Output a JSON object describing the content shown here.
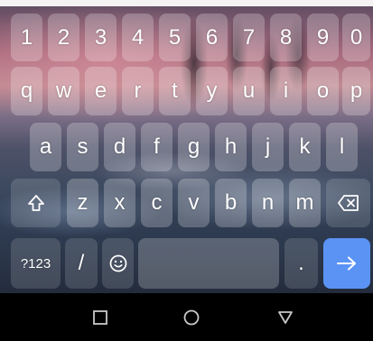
{
  "keyboard": {
    "numbers": [
      "1",
      "2",
      "3",
      "4",
      "5",
      "6",
      "7",
      "8",
      "9",
      "0"
    ],
    "row_q": [
      "q",
      "w",
      "e",
      "r",
      "t",
      "y",
      "u",
      "i",
      "o",
      "p"
    ],
    "row_a": [
      "a",
      "s",
      "d",
      "f",
      "g",
      "h",
      "j",
      "k",
      "l"
    ],
    "row_z": [
      "z",
      "x",
      "c",
      "v",
      "b",
      "n",
      "m"
    ],
    "symbols_label": "?123",
    "slash_label": "/",
    "period_label": ".",
    "icons": {
      "shift": "shift-arrow-icon",
      "backspace": "backspace-icon",
      "emoji": "smiley-icon",
      "enter": "arrow-right-icon"
    },
    "accent_color": "#5b93f5"
  },
  "navigation_bar": {
    "icons": [
      "recent-apps-square-icon",
      "home-circle-icon",
      "back-triangle-icon"
    ]
  }
}
